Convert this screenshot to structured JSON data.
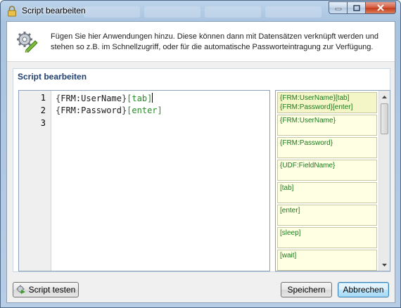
{
  "window": {
    "title": "Script bearbeiten",
    "title_icon": "lock-icon",
    "controls": {
      "minimize_icon": "minimize-icon",
      "maximize_icon": "maximize-icon",
      "close_icon": "close-icon"
    }
  },
  "info": {
    "icon": "gear-pencil-icon",
    "text": "Fügen Sie hier Anwendungen hinzu. Diese können dann mit Datensätzen verknüpft werden und stehen so z.B. im Schnellzugriff, oder für die automatische Passworteintragung zur Verfügung."
  },
  "editor_group": {
    "title": "Script bearbeiten",
    "lines": [
      {
        "number": "1",
        "tokens": [
          {
            "type": "brace",
            "text": "{"
          },
          {
            "type": "field",
            "text": "FRM:UserName"
          },
          {
            "type": "brace",
            "text": "}"
          },
          {
            "type": "tok",
            "text": "[tab]"
          }
        ]
      },
      {
        "number": "2",
        "tokens": [
          {
            "type": "brace",
            "text": "{"
          },
          {
            "type": "field",
            "text": "FRM:Password"
          },
          {
            "type": "brace",
            "text": "}"
          },
          {
            "type": "tok",
            "text": "[enter]"
          }
        ]
      },
      {
        "number": "3",
        "tokens": []
      }
    ]
  },
  "snippets": [
    {
      "lines": [
        "{FRM:UserName}[tab]",
        "{FRM:Password}[enter]"
      ],
      "selected": true
    },
    {
      "lines": [
        "{FRM:UserName}"
      ]
    },
    {
      "lines": [
        "{FRM:Password}"
      ]
    },
    {
      "lines": [
        "{UDF:FieldName}"
      ]
    },
    {
      "lines": [
        "[tab]"
      ]
    },
    {
      "lines": [
        "[enter]"
      ]
    },
    {
      "lines": [
        "[sleep]"
      ]
    },
    {
      "lines": [
        "[wait]"
      ]
    }
  ],
  "buttons": {
    "test_label": "Script testen",
    "test_icon": "gear-play-icon",
    "save_label": "Speichern",
    "cancel_label": "Abbrechen"
  },
  "colors": {
    "token_green": "#2b8a2b",
    "snippet_bg": "#ffffe3",
    "group_title": "#1f3f71"
  }
}
